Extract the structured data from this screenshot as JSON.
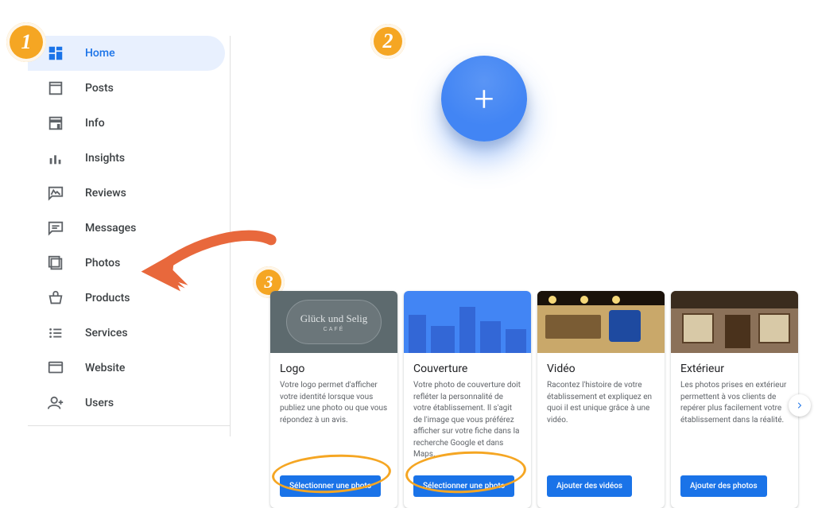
{
  "sidebar": {
    "items": [
      {
        "key": "home",
        "label": "Home",
        "icon": "dashboard"
      },
      {
        "key": "posts",
        "label": "Posts",
        "icon": "post"
      },
      {
        "key": "info",
        "label": "Info",
        "icon": "storefront"
      },
      {
        "key": "insights",
        "label": "Insights",
        "icon": "insights"
      },
      {
        "key": "reviews",
        "label": "Reviews",
        "icon": "review"
      },
      {
        "key": "messages",
        "label": "Messages",
        "icon": "message"
      },
      {
        "key": "photos",
        "label": "Photos",
        "icon": "photos"
      },
      {
        "key": "products",
        "label": "Products",
        "icon": "basket"
      },
      {
        "key": "services",
        "label": "Services",
        "icon": "list"
      },
      {
        "key": "website",
        "label": "Website",
        "icon": "website"
      },
      {
        "key": "users",
        "label": "Users",
        "icon": "person-add"
      }
    ],
    "active": "home"
  },
  "annotations": {
    "badge1": "1",
    "badge2": "2",
    "badge3": "3"
  },
  "cards": [
    {
      "title": "Logo",
      "desc": "Votre logo permet d'afficher votre identité lorsque vous publiez une photo ou que vous répondez à un avis.",
      "button": "Sélectionner une photo",
      "thumb": "logo",
      "thumb_text": "Glück und Selig",
      "thumb_sub": "CAFÉ"
    },
    {
      "title": "Couverture",
      "desc": "Votre photo de couverture doit refléter la personnalité de votre établissement. Il s'agit de l'image que vous préférez afficher sur votre fiche dans la recherche Google et dans Maps.",
      "button": "Sélectionner une photo",
      "thumb": "cover"
    },
    {
      "title": "Vidéo",
      "desc": "Racontez l'histoire de votre établissement et expliquez en quoi il est unique grâce à une vidéo.",
      "button": "Ajouter des vidéos",
      "thumb": "shop"
    },
    {
      "title": "Extérieur",
      "desc": "Les photos prises en extérieur permettent à vos clients de repérer plus facilement votre établissement dans la réalité.",
      "button": "Ajouter des photos",
      "thumb": "ext"
    }
  ]
}
